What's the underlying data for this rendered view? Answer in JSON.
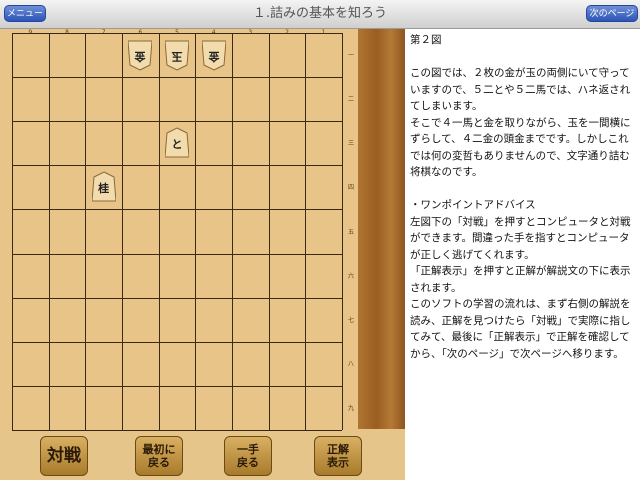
{
  "header": {
    "menu_label": "メニュー",
    "title": "１.詰みの基本を知ろう",
    "next_label": "次のページ"
  },
  "board": {
    "col_labels": [
      "9",
      "8",
      "7",
      "6",
      "5",
      "4",
      "3",
      "2",
      "1"
    ],
    "row_labels": [
      "一",
      "二",
      "三",
      "四",
      "五",
      "六",
      "七",
      "八",
      "九"
    ],
    "pieces": [
      {
        "label": "金",
        "side": "gote",
        "file": 6,
        "rank": 1
      },
      {
        "label": "玉",
        "side": "gote",
        "file": 5,
        "rank": 1
      },
      {
        "label": "金",
        "side": "gote",
        "file": 4,
        "rank": 1
      },
      {
        "label": "と",
        "side": "sente",
        "file": 5,
        "rank": 3
      },
      {
        "label": "桂",
        "side": "sente",
        "file": 7,
        "rank": 4
      }
    ]
  },
  "buttons": {
    "battle": "対戦",
    "first": "最初に\n戻る",
    "back": "一手\n戻る",
    "answer": "正解\n表示"
  },
  "explanation": {
    "text": "第２図\n\nこの図では、２枚の金が玉の両側にいて守っていますので、５二とや５二馬では、ハネ返されてしまいます。\nそこで４一馬と金を取りながら、玉を一間横にずらして、４二金の頭金までです。しかしこれでは何の変哲もありませんので、文字通り詰む将棋なのです。\n\n・ワンポイントアドバイス\n左図下の「対戦」を押すとコンピュータと対戦ができます。間違った手を指すとコンピュータが正しく逃げてくれます。\n「正解表示」を押すと正解が解説文の下に表示されます。\nこのソフトの学習の流れは、まず右側の解説を読み、正解を見つけたら「対戦」で実際に指してみて、最後に「正解表示」で正解を確認してから、「次のページ」で次ページへ移ります。"
  }
}
